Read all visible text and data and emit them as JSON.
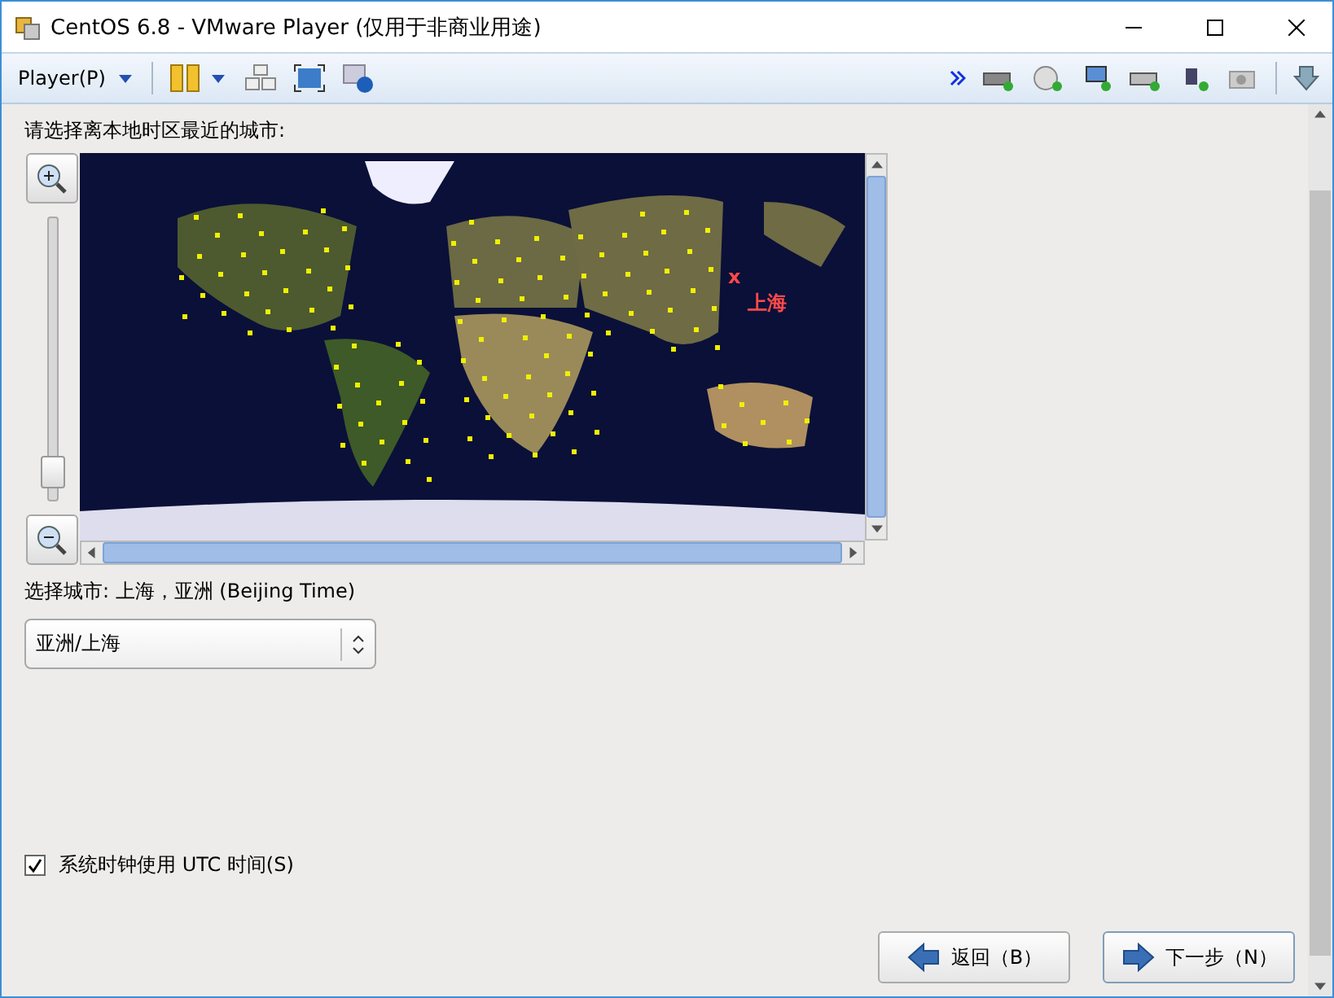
{
  "window": {
    "title": "CentOS 6.8 - VMware Player (仅用于非商业用途)"
  },
  "toolbar": {
    "menu": "Player(P)"
  },
  "prompt": "请选择离本地时区最近的城市:",
  "map": {
    "zoom": {
      "level": 0.1
    },
    "marker": {
      "symbol": "x",
      "label": "上海"
    }
  },
  "selected_city": "选择城市: 上海，亚洲 (Beijing Time)",
  "timezone_select": {
    "value": "亚洲/上海"
  },
  "utc_checkbox": {
    "label": "系统时钟使用 UTC 时间(S)",
    "checked": true
  },
  "buttons": [
    {
      "kind": "back",
      "label": "返回（B）"
    },
    {
      "kind": "next",
      "label": "下一步（N）"
    }
  ]
}
